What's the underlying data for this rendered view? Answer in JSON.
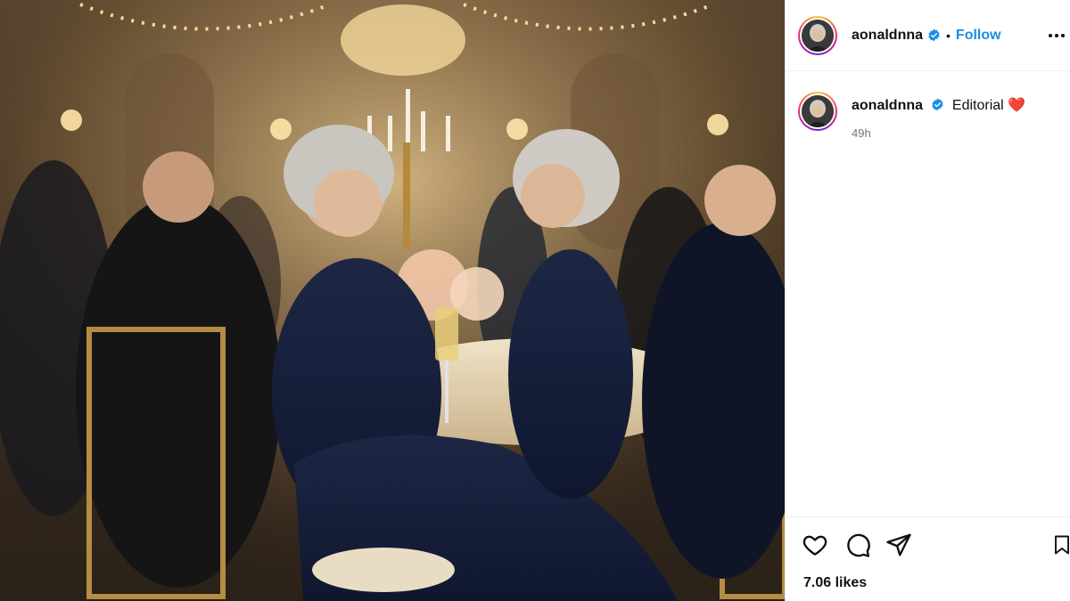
{
  "post": {
    "username": "aonaldnna",
    "verified": true,
    "follow_label": "Follow",
    "separator": "•",
    "caption": "Editorial",
    "caption_emoji": "❤️",
    "time_ago": "49h",
    "likes": "7.06 likes"
  },
  "icons": {
    "verified": "verified-badge-icon",
    "more": "more-options-icon",
    "like": "heart-icon",
    "comment": "comment-icon",
    "share": "paper-plane-icon",
    "save": "bookmark-icon"
  },
  "colors": {
    "follow": "#1b8fe6",
    "verified": "#1b8fe6",
    "heart_emoji": "#e0245e",
    "timestamp": "#737373"
  },
  "photo": {
    "description_icon": "photo-image"
  }
}
